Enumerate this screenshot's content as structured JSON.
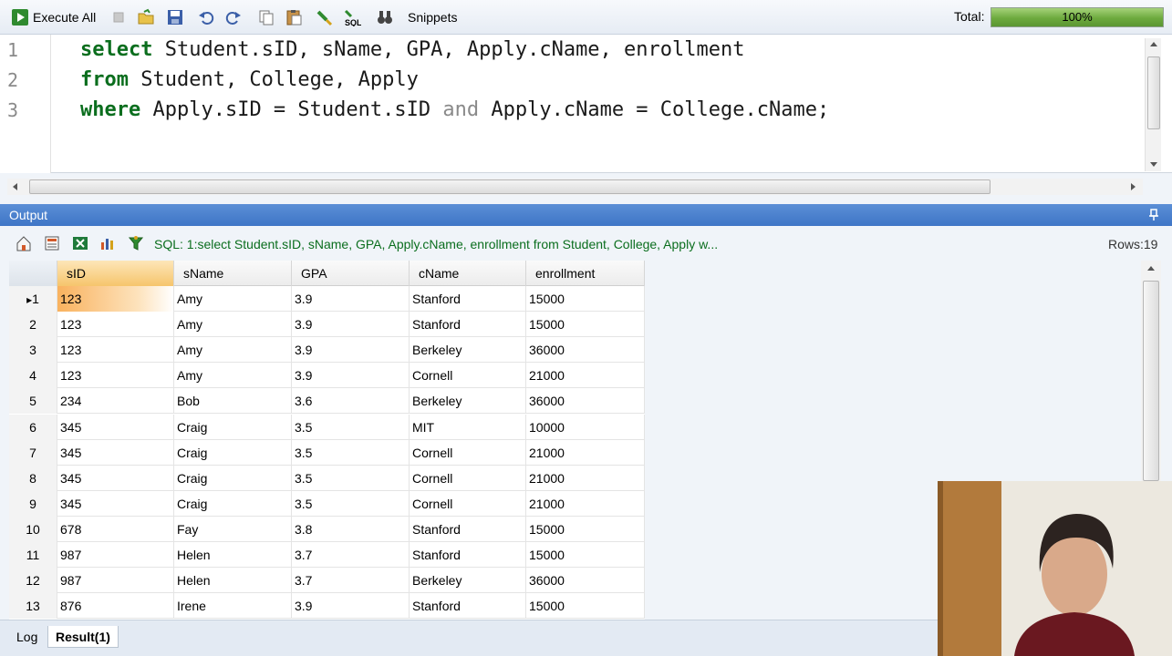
{
  "toolbar": {
    "execute_all_label": "Execute All",
    "snippets_label": "Snippets",
    "total_label": "Total:",
    "total_progress_text": "100%",
    "total_progress_value": 1.0,
    "colors": {
      "progress": "#6daa3e"
    }
  },
  "editor": {
    "line_numbers": [
      "1",
      "2",
      "3"
    ],
    "lines": [
      [
        {
          "t": "select",
          "k": "kw"
        },
        {
          "t": " Student.sID, sName, GPA, Apply.cName, enrollment",
          "k": ""
        }
      ],
      [
        {
          "t": "from",
          "k": "kw"
        },
        {
          "t": " Student, College, Apply",
          "k": ""
        }
      ],
      [
        {
          "t": "where",
          "k": "kw"
        },
        {
          "t": " Apply.sID = Student.sID ",
          "k": ""
        },
        {
          "t": "and",
          "k": "op"
        },
        {
          "t": " Apply.cName = College.cName;",
          "k": ""
        }
      ]
    ]
  },
  "output": {
    "title": "Output",
    "sql_summary": "SQL: 1:select Student.sID, sName, GPA, Apply.cName, enrollment  from Student, College, Apply  w...",
    "rows_label": "Rows:19"
  },
  "grid": {
    "columns": [
      "sID",
      "sName",
      "GPA",
      "cName",
      "enrollment"
    ],
    "rows": [
      [
        "1",
        "123",
        "Amy",
        "3.9",
        "Stanford",
        "15000"
      ],
      [
        "2",
        "123",
        "Amy",
        "3.9",
        "Stanford",
        "15000"
      ],
      [
        "3",
        "123",
        "Amy",
        "3.9",
        "Berkeley",
        "36000"
      ],
      [
        "4",
        "123",
        "Amy",
        "3.9",
        "Cornell",
        "21000"
      ],
      [
        "5",
        "234",
        "Bob",
        "3.6",
        "Berkeley",
        "36000"
      ],
      [
        "6",
        "345",
        "Craig",
        "3.5",
        "MIT",
        "10000"
      ],
      [
        "7",
        "345",
        "Craig",
        "3.5",
        "Cornell",
        "21000"
      ],
      [
        "8",
        "345",
        "Craig",
        "3.5",
        "Cornell",
        "21000"
      ],
      [
        "9",
        "345",
        "Craig",
        "3.5",
        "Cornell",
        "21000"
      ],
      [
        "10",
        "678",
        "Fay",
        "3.8",
        "Stanford",
        "15000"
      ],
      [
        "11",
        "987",
        "Helen",
        "3.7",
        "Stanford",
        "15000"
      ],
      [
        "12",
        "987",
        "Helen",
        "3.7",
        "Berkeley",
        "36000"
      ],
      [
        "13",
        "876",
        "Irene",
        "3.9",
        "Stanford",
        "15000"
      ]
    ]
  },
  "tabs": {
    "log_label": "Log",
    "result_label": "Result(1)"
  },
  "icons": {
    "execute": "play-icon",
    "stop": "stop-icon",
    "open": "open-folder-icon",
    "save": "save-icon",
    "undo": "undo-icon",
    "redo": "redo-icon",
    "copy": "copy-icon",
    "paste": "paste-icon",
    "format": "format-brush-icon",
    "sql": "sql-icon",
    "snippets": "binoculars-icon"
  }
}
